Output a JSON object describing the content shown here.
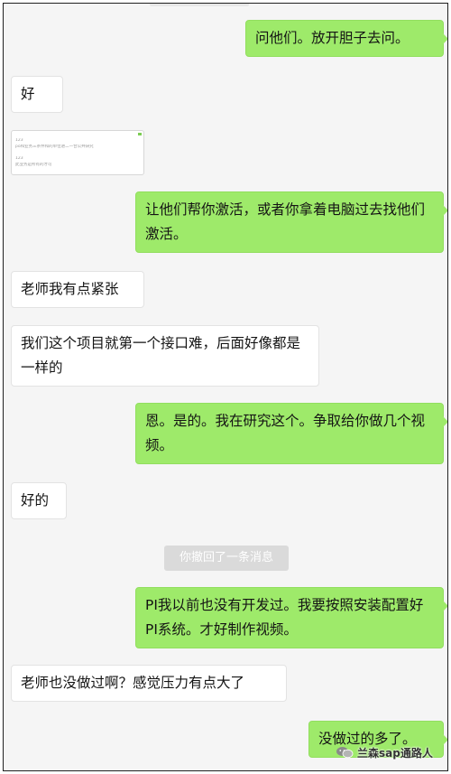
{
  "colors": {
    "background": "#f5f5f5",
    "outgoing_bubble": "#9eea6a",
    "incoming_bubble": "#ffffff",
    "system_notice": "#dadada"
  },
  "messages": [
    {
      "side": "right",
      "text": "问他们。放开胆子去问。"
    },
    {
      "side": "left",
      "text": "好"
    },
    {
      "side": "left",
      "type": "quote-card",
      "lines": [
        "123",
        "po和业务三条件和的单位进二一合公共研究",
        "123",
        "此业务是所有的才可"
      ]
    },
    {
      "side": "right",
      "text": "让他们帮你激活，或者你拿着电脑过去找他们激活。"
    },
    {
      "side": "left",
      "text": "老师我有点紧张"
    },
    {
      "side": "left",
      "text": "我们这个项目就第一个接口难，后面好像都是一样的"
    },
    {
      "side": "right",
      "text": "恩。是的。我在研究这个。争取给你做几个视频。"
    },
    {
      "side": "left",
      "text": "好的"
    },
    {
      "side": "right",
      "text": "PI我以前也没有开发过。我要按照安装配置好PI系统。才好制作视频。"
    },
    {
      "side": "left",
      "text": "老师也没做过啊？感觉压力有点大了"
    },
    {
      "side": "right",
      "text": "没做过的多了。"
    }
  ],
  "system_notice": "你撤回了一条消息",
  "watermark": {
    "icon": "wechat-logo-icon",
    "text": "兰森sap通路人"
  }
}
